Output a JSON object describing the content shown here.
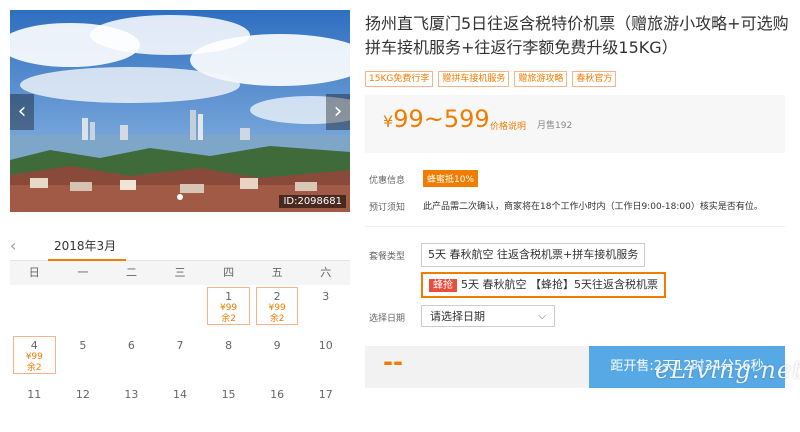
{
  "hero": {
    "image_id": "ID:2098681",
    "prev_icon": "chevron-left-icon",
    "next_icon": "chevron-right-icon"
  },
  "calendar": {
    "month": "2018年3月",
    "weekdays": [
      "日",
      "一",
      "二",
      "三",
      "四",
      "五",
      "六"
    ],
    "rows": [
      [
        {
          "d": ""
        },
        {
          "d": ""
        },
        {
          "d": ""
        },
        {
          "d": ""
        },
        {
          "d": "1",
          "p": "¥99",
          "s": "余2"
        },
        {
          "d": "2",
          "p": "¥99",
          "s": "余2"
        },
        {
          "d": "3"
        }
      ],
      [
        {
          "d": "4",
          "p": "¥99",
          "s": "余2"
        },
        {
          "d": "5"
        },
        {
          "d": "6"
        },
        {
          "d": "7"
        },
        {
          "d": "8"
        },
        {
          "d": "9"
        },
        {
          "d": "10"
        }
      ],
      [
        {
          "d": "11"
        },
        {
          "d": "12"
        },
        {
          "d": "13"
        },
        {
          "d": "14"
        },
        {
          "d": "15"
        },
        {
          "d": "16"
        },
        {
          "d": "17"
        }
      ]
    ]
  },
  "product": {
    "title": "扬州直飞厦门5日往返含税特价机票（赠旅游小攻略+可选购拼车接机服务+往返行李额免费升级15KG）",
    "tags": [
      "15KG免费行李",
      "赠拼车接机服务",
      "赠旅游攻略",
      "春秋官方"
    ],
    "price": "99~599",
    "currency": "¥",
    "price_note": "价格说明",
    "sold": "月售192",
    "promo_label": "优惠信息",
    "promo_badge": "蜂蜜抵10%",
    "notice_label": "预订须知",
    "notice_text": "此产品需二次确认，商家将在18个工作小时内（工作日9:00-18:00）核实是否有位。",
    "package_label": "套餐类型",
    "packages": [
      {
        "badge": "",
        "text": "5天 春秋航空 往返含税机票+拼车接机服务"
      },
      {
        "badge": "蜂抢",
        "text": "5天 春秋航空 【蜂抢】5天往返含税机票"
      }
    ],
    "date_label": "选择日期",
    "date_placeholder": "请选择日期",
    "buy_price": "--",
    "countdown": "距开售:2天12时34分56秒"
  },
  "watermark": "eLiving.net"
}
